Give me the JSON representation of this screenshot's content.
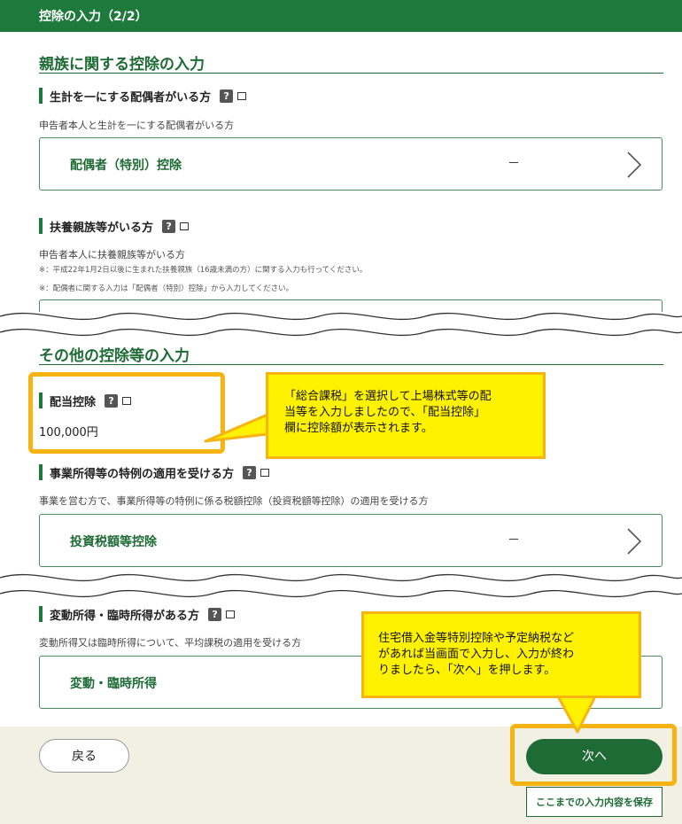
{
  "header": {
    "title": "控除の入力（2/2）"
  },
  "family_section": {
    "title": "親族に関する控除の入力",
    "spouse": {
      "label": "生計を一にする配偶者がいる方",
      "description": "申告者本人と生計を一にする配偶者がいる方",
      "card_label": "配偶者（特別）控除",
      "card_value": "－"
    },
    "dependents": {
      "label": "扶養親族等がいる方",
      "description": "申告者本人に扶養親族等がいる方",
      "note1": "※：平成22年1月2日以後に生まれた扶養親族（16歳未満の方）に関する入力も行ってください。",
      "note2": "※：配偶者に関する入力は「配偶者（特別）控除」から入力してください。"
    }
  },
  "other_section": {
    "title": "その他の控除等の入力",
    "dividend": {
      "label": "配当控除",
      "amount": "100,000円"
    },
    "business": {
      "label": "事業所得等の特例の適用を受ける方",
      "description": "事業を営む方で、事業所得等の特例に係る税額控除（投資税額等控除）の適用を受ける方",
      "card_label": "投資税額等控除",
      "card_value": "－"
    },
    "variable": {
      "label": "変動所得・臨時所得がある方",
      "description": "変動所得又は臨時所得について、平均課税の適用を受ける方",
      "card_label": "変動・臨時所得"
    }
  },
  "icons": {
    "help": "?"
  },
  "footer": {
    "back_label": "戻る",
    "next_label": "次へ",
    "save_label": "ここまでの入力内容を保存"
  },
  "callouts": {
    "dividend": [
      "「総合課税」を選択して上場株式等の配",
      "当等を入力しましたので、「配当控除」",
      "欄に控除額が表示されます。"
    ],
    "next": [
      "住宅借入金等特別控除や予定納税など",
      "があれば当画面で入力し、入力が終わ",
      "りましたら、「次へ」を押します。"
    ]
  },
  "colors": {
    "brand_green": "#1e7a3c",
    "highlight_orange": "#f6b312",
    "callout_yellow": "#fff200",
    "footer_bg": "#f2efe3"
  }
}
